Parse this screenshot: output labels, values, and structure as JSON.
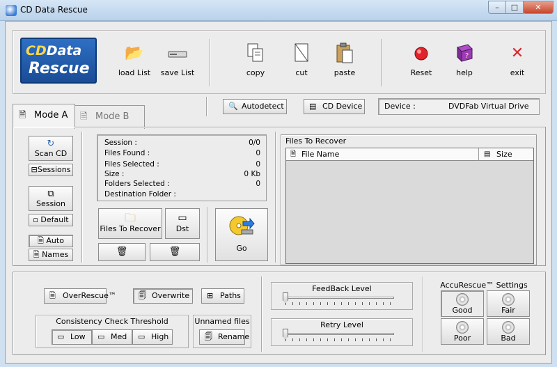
{
  "window": {
    "title": "CD Data Rescue",
    "minimize": "–",
    "maximize": "□",
    "close": "✕"
  },
  "logo": {
    "line1_cd": "CD",
    "line1_rest": "Data",
    "line2": "Rescue"
  },
  "toolbar": {
    "load_list": "load List",
    "save_list": "save List",
    "copy": "copy",
    "cut": "cut",
    "paste": "paste",
    "reset": "Reset",
    "help": "help",
    "exit": "exit"
  },
  "tabs": {
    "mode_a": "Mode A",
    "mode_b": "Mode B"
  },
  "topbar": {
    "autodetect": "Autodetect",
    "cd_device": "CD Device",
    "device_label": "Device :",
    "device_value": "DVDFab Virtual Drive"
  },
  "left": {
    "scan_cd": "Scan CD",
    "sessions": "Sessions",
    "session": "Session",
    "default": "Default",
    "auto": "Auto",
    "names": "Names"
  },
  "stats": {
    "session_label": "Session :",
    "session_value": "0/0",
    "files_found_label": "Files Found :",
    "files_found_value": "0",
    "files_selected_label": "Files Selected :",
    "files_selected_value": "0",
    "size_label": "Size :",
    "size_value": "0 Kb",
    "folders_selected_label": "Folders Selected :",
    "folders_selected_value": "0",
    "destination_label": "Destination Folder :"
  },
  "actions": {
    "files_to_recover": "Files To Recover",
    "dst": "Dst",
    "go": "Go"
  },
  "files": {
    "legend": "Files To Recover",
    "col_name": "File Name",
    "col_size": "Size"
  },
  "bottom": {
    "overrescue": "OverRescue™",
    "overwrite": "Overwrite",
    "paths": "Paths",
    "consistency_title": "Consistency Check Threshold",
    "low": "Low",
    "med": "Med",
    "high": "High",
    "unnamed_title": "Unnamed files",
    "rename": "Rename",
    "feedback_level": "FeedBack Level",
    "feedback_value": 0,
    "retry_level": "Retry Level",
    "retry_value": 0,
    "accurescue_title": "AccuRescue™ Settings",
    "good": "Good",
    "fair": "Fair",
    "poor": "Poor",
    "bad": "Bad"
  }
}
